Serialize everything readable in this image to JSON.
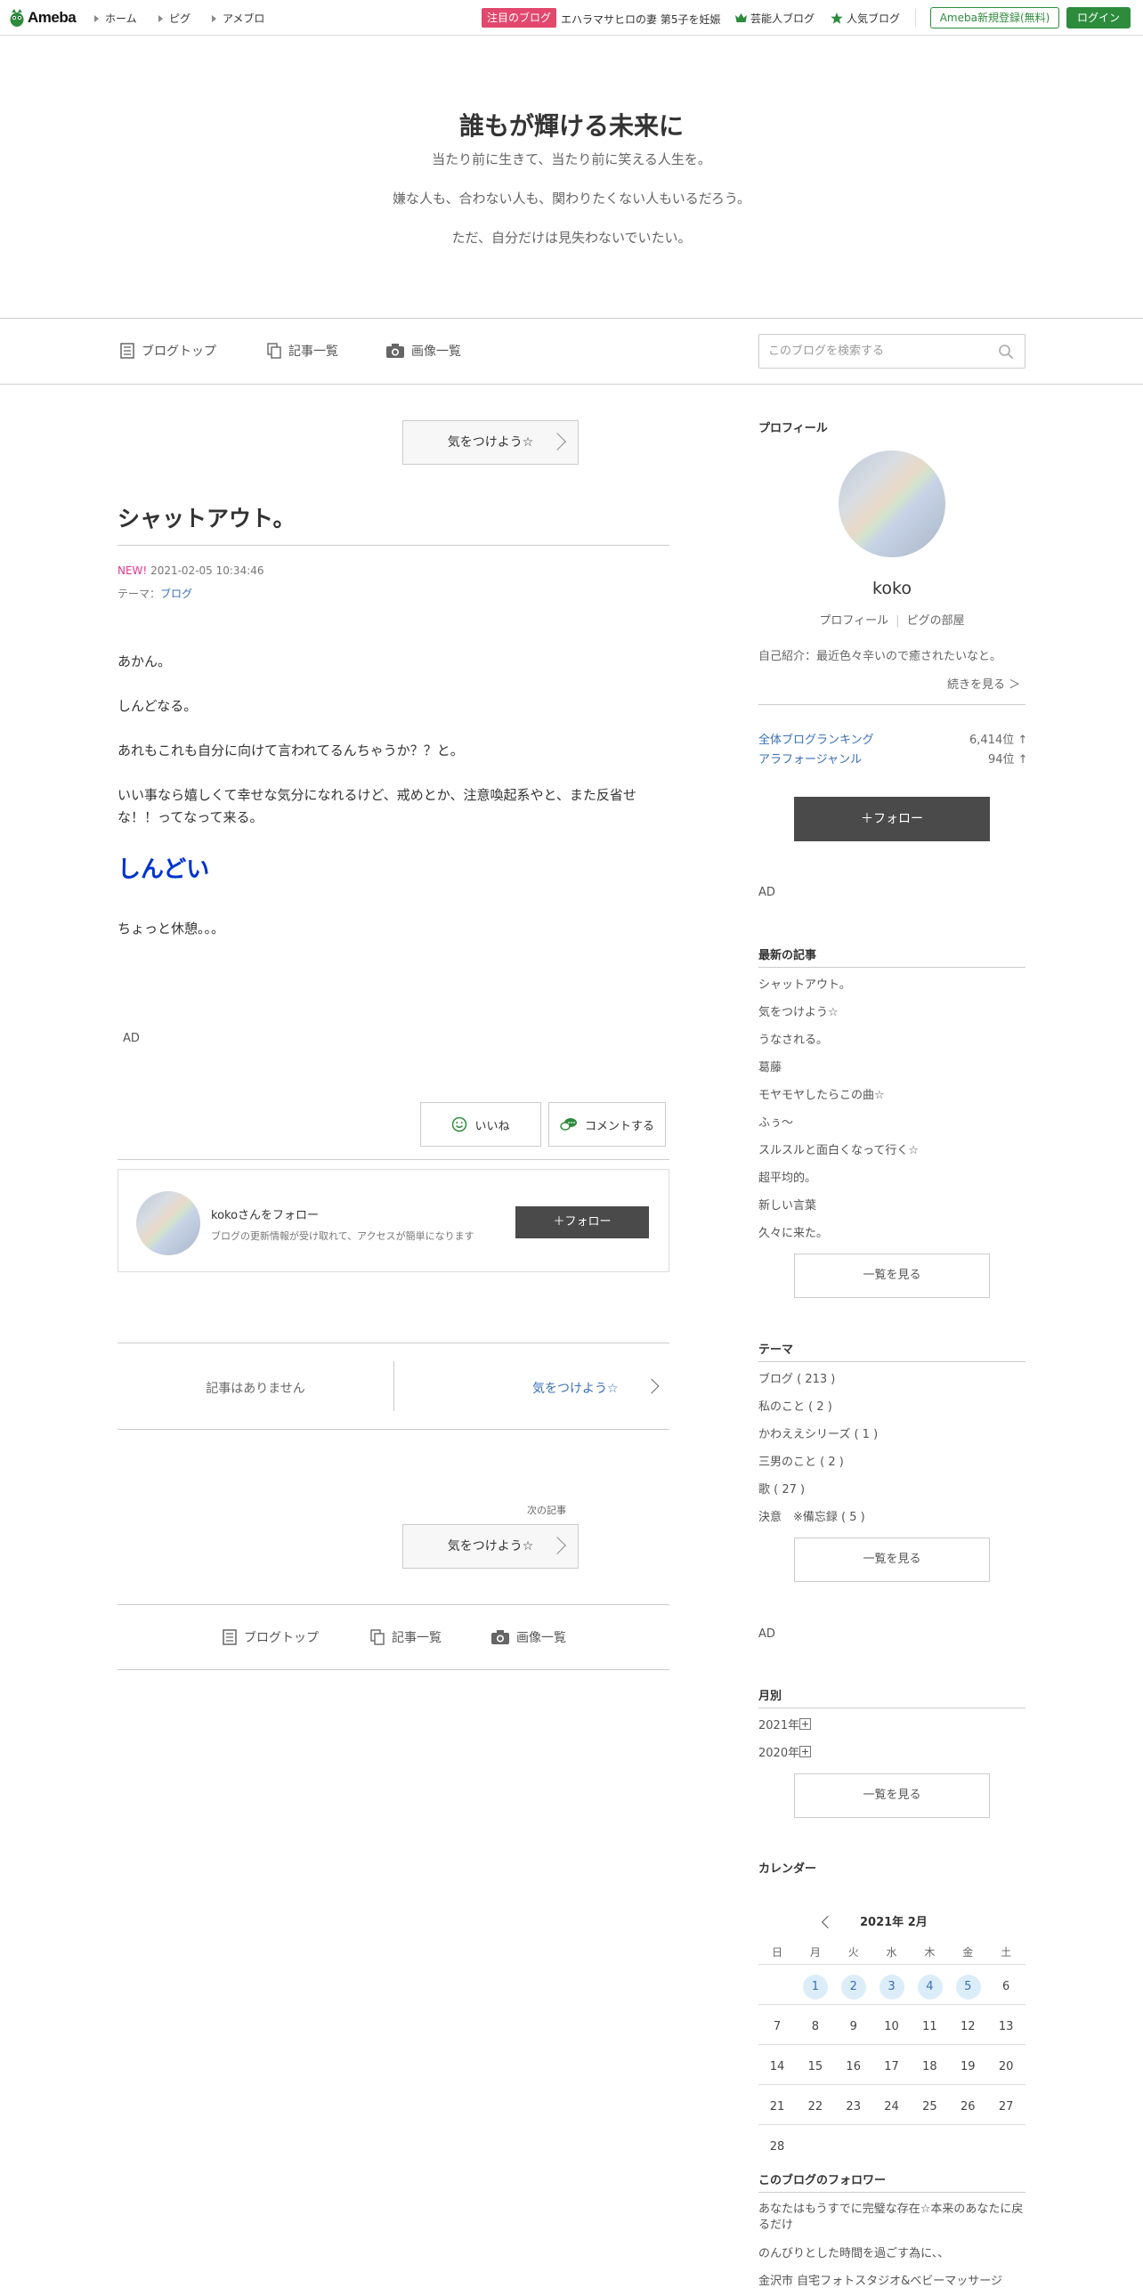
{
  "topbar": {
    "logo": "Ameba",
    "nav": [
      "ホーム",
      "ピグ",
      "アメブロ"
    ],
    "pickup_tag": "注目のブログ",
    "pickup_text": "エハラマサヒロの妻 第5子を妊娠",
    "celebrity": "芸能人ブログ",
    "popular": "人気ブログ",
    "register": "Ameba新規登録(無料)",
    "login": "ログイン"
  },
  "header": {
    "title": "誰もが輝ける未来に",
    "desc": [
      "当たり前に生きて、当たり前に笑える人生を。",
      "嫌な人も、合わない人も、関わりたくない人もいるだろう。",
      "ただ、自分だけは見失わないでいたい。"
    ]
  },
  "subnav": {
    "top": "ブログトップ",
    "list": "記事一覧",
    "images": "画像一覧",
    "search_placeholder": "このブログを検索する"
  },
  "article": {
    "prev_title": "気をつけよう☆",
    "title": "シャットアウト。",
    "new": "NEW!",
    "date": "2021-02-05 10:34:46",
    "theme_label": "テーマ：",
    "theme": "ブログ",
    "paragraphs": [
      "あかん。",
      "しんどなる。",
      "あれもこれも自分に向けて言われてるんちゃうか？？と。",
      "いい事なら嬉しくて幸せな気分になれるけど、戒めとか、注意喚起系やと、また反省せな！！ってなって来る。"
    ],
    "big_text": "しんどい",
    "last": "ちょっと休憩。。。",
    "ad": "AD",
    "like": "いいね",
    "comment": "コメントする"
  },
  "followbox": {
    "title": "kokoさんをフォロー",
    "desc": "ブログの更新情報が受け取れて、アクセスが簡単になります",
    "button": "＋フォロー"
  },
  "pager": {
    "none": "記事はありません",
    "next": "気をつけよう☆",
    "next_label": "次の記事",
    "next_btn": "気をつけよう☆"
  },
  "bottomnav": {
    "top": "ブログトップ",
    "list": "記事一覧",
    "images": "画像一覧"
  },
  "sidebar": {
    "profile_h": "プロフィール",
    "name": "koko",
    "profile_link": "プロフィール",
    "pig_link": "ピグの部屋",
    "intro": "自己紹介：最近色々辛いので癒されたいなと。",
    "read_more": "続きを見る ＞",
    "rank1_label": "全体ブログランキング",
    "rank1_value": "6,414位 ↑",
    "rank2_label": "アラフォージャンル",
    "rank2_value": "94位 ↑",
    "follow": "＋フォロー",
    "ad1": "AD",
    "latest_h": "最新の記事",
    "latest": [
      "シャットアウト。",
      "気をつけよう☆",
      "うなされる。",
      "葛藤",
      "モヤモヤしたらこの曲☆",
      "ふぅ〜",
      "スルスルと面白くなって行く☆",
      "超平均的。",
      "新しい言葉",
      "久々に来た。"
    ],
    "more": "一覧を見る",
    "theme_h": "テーマ",
    "themes": [
      "ブログ ( 213 )",
      "私のこと ( 2 )",
      "かわええシリーズ ( 1 )",
      "三男のこと ( 2 )",
      "歌 ( 27 )",
      "決意　※備忘録 ( 5 )"
    ],
    "ad2": "AD",
    "monthly_h": "月別",
    "months": [
      "2021年",
      "2020年"
    ],
    "calendar_h": "カレンダー",
    "cal_month": "2021年 2月",
    "weekdays": [
      "日",
      "月",
      "火",
      "水",
      "木",
      "金",
      "土"
    ],
    "days": [
      "1",
      "2",
      "3",
      "4",
      "5",
      "6",
      "7",
      "8",
      "9",
      "10",
      "11",
      "12",
      "13",
      "14",
      "15",
      "16",
      "17",
      "18",
      "19",
      "20",
      "21",
      "22",
      "23",
      "24",
      "25",
      "26",
      "27",
      "28"
    ],
    "followers_h": "このブログのフォロワー",
    "followers": [
      "あなたはもうすでに完璧な存在☆本来のあなたに戻るだけ",
      "のんびりとした時間を過ごす為に、、",
      "金沢市 自宅フォトスタジオ&ベビーマッサージ"
    ]
  },
  "colors": {
    "accent": "#2d8c3c",
    "link": "#3970b5",
    "pickup": "#e2476d",
    "big_text": "#0033cc"
  }
}
